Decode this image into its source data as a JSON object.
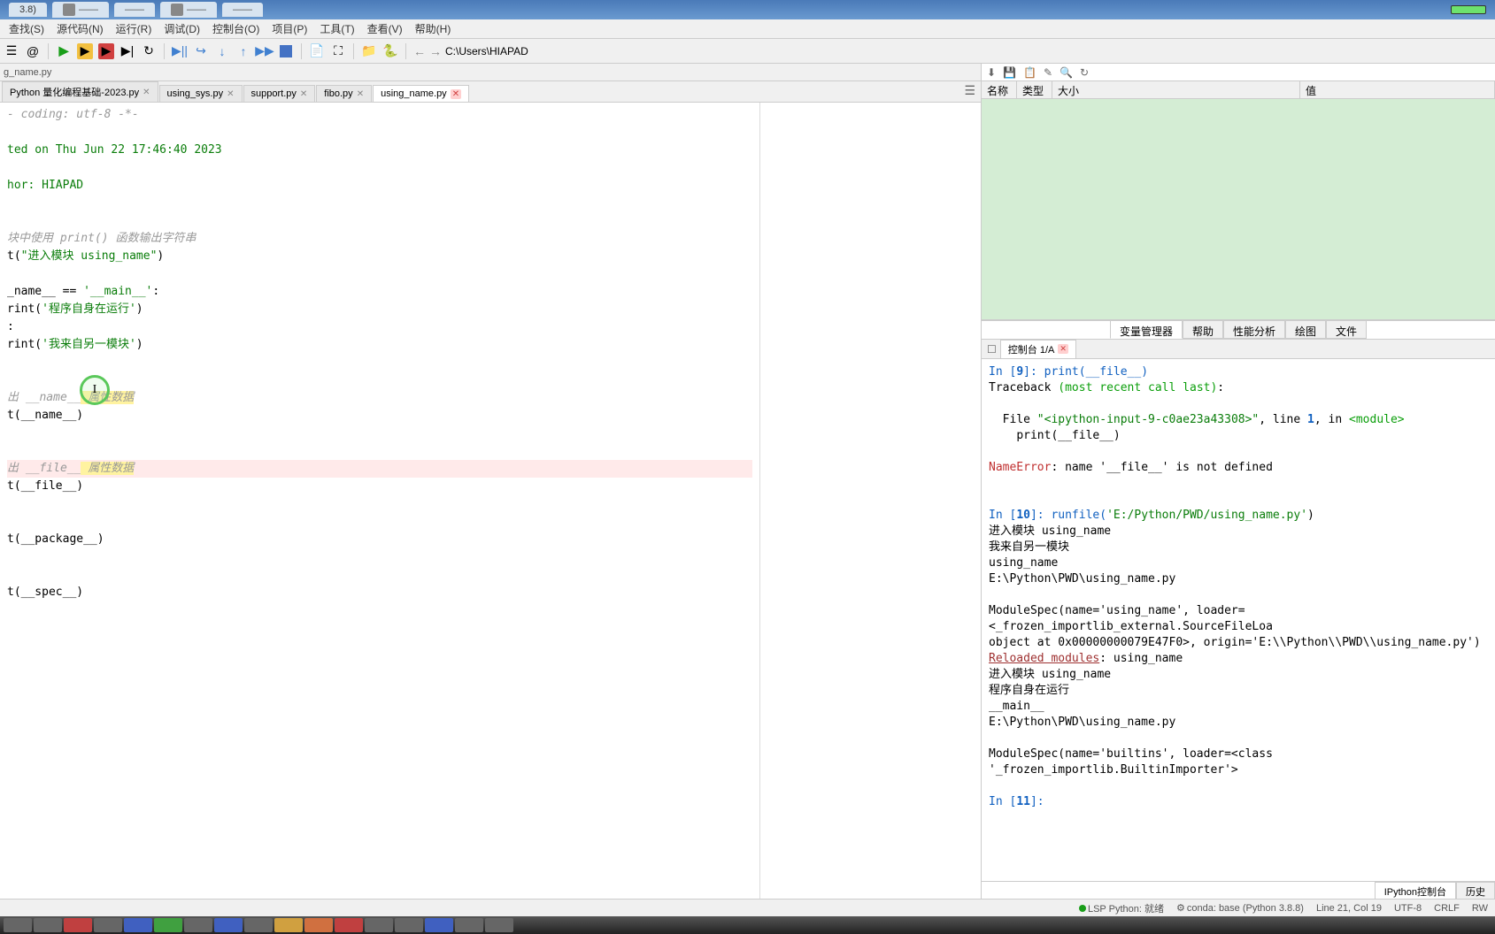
{
  "top_tabs": {
    "tab1": "3.8)",
    "blurred": [
      "——",
      "——",
      "——",
      "——"
    ]
  },
  "menu": {
    "search": "查找(S)",
    "source": "源代码(N)",
    "run": "运行(R)",
    "debug": "调试(D)",
    "console": "控制台(O)",
    "project": "项目(P)",
    "tools": "工具(T)",
    "view": "查看(V)",
    "help": "帮助(H)"
  },
  "toolbar_path": "C:\\Users\\HIAPAD",
  "file_path_label": "g_name.py",
  "editor_tabs": {
    "tab1": "Python 量化编程基础-2023.py",
    "tab2": "using_sys.py",
    "tab3": "support.py",
    "tab4": "fibo.py",
    "tab5": "using_name.py"
  },
  "code": {
    "l1": "- coding: utf-8 -*-",
    "l2": "ted on Thu Jun 22 17:46:40 2023",
    "l3": "hor: HIAPAD",
    "l4a": "块中使用 print() 函数输出字符串",
    "l5a": "t(",
    "l5b": "\"进入模块 using_name\"",
    "l5c": ")",
    "l6a": "_name__ == ",
    "l6b": "'__main__'",
    "l6c": ":",
    "l7a": "rint(",
    "l7b": "'程序自身在运行'",
    "l7c": ")",
    "l8": ":",
    "l9a": "rint(",
    "l9b": "'我来自另一模块'",
    "l9c": ")",
    "l10a": "出 ",
    "l10b": "__name__",
    "l10c": " 属性数据",
    "l11": "t(__name__)",
    "l12a": "出 ",
    "l12b": "__file__",
    "l12c": " 属性数据",
    "l13": "t(__file__)",
    "l14": "t(__package__)",
    "l15": "t(__spec__)"
  },
  "cursor_char": "I",
  "var_header": {
    "name": "名称",
    "type": "类型",
    "size": "大小",
    "value": "值"
  },
  "right_tabs": {
    "var": "变量管理器",
    "help": "帮助",
    "perf": "性能分析",
    "plot": "绘图",
    "file": "文件"
  },
  "console_tab": "控制台 1/A",
  "console": {
    "in9_pre": "In [",
    "in9_num": "9",
    "in9_post": "]: print(__file__)",
    "l2a": "Traceback ",
    "l2b": "(most recent call last)",
    "l2c": ":",
    "l3a": "  File ",
    "l3b": "\"<ipython-input-9-c0ae23a43308>\"",
    "l3c": ", line ",
    "l3d": "1",
    "l3e": ", in ",
    "l3f": "<module>",
    "l4": "    print(__file__)",
    "l5a": "NameError",
    "l5b": ": name '__file__' is not defined",
    "in10_pre": "In [",
    "in10_num": "10",
    "in10_post": "]: runfile(",
    "in10_str": "'E:/Python/PWD/using_name.py'",
    "in10_end": ")",
    "o1": "进入模块 using_name",
    "o2": "我来自另一模块",
    "o3": "using_name",
    "o4": "E:\\Python\\PWD\\using_name.py",
    "o5": "ModuleSpec(name='using_name', loader=<_frozen_importlib_external.SourceFileLoa",
    "o6": "object at 0x00000000079E47F0>, origin='E:\\\\Python\\\\PWD\\\\using_name.py')",
    "o7a": "Reloaded modules",
    "o7b": ": using_name",
    "o8": "进入模块 using_name",
    "o9": "程序自身在运行",
    "o10": "__main__",
    "o11": "E:\\Python\\PWD\\using_name.py",
    "o12": "ModuleSpec(name='builtins', loader=<class '_frozen_importlib.BuiltinImporter'>",
    "in11_pre": "In [",
    "in11_num": "11",
    "in11_post": "]: "
  },
  "console_bottom_tabs": {
    "ipython": "IPython控制台",
    "history": "历史"
  },
  "status": {
    "lsp": "LSP Python: 就绪",
    "conda": "conda: base (Python 3.8.8)",
    "pos": "Line 21, Col 19",
    "enc": "UTF-8",
    "eol": "CRLF",
    "rw": "RW"
  }
}
